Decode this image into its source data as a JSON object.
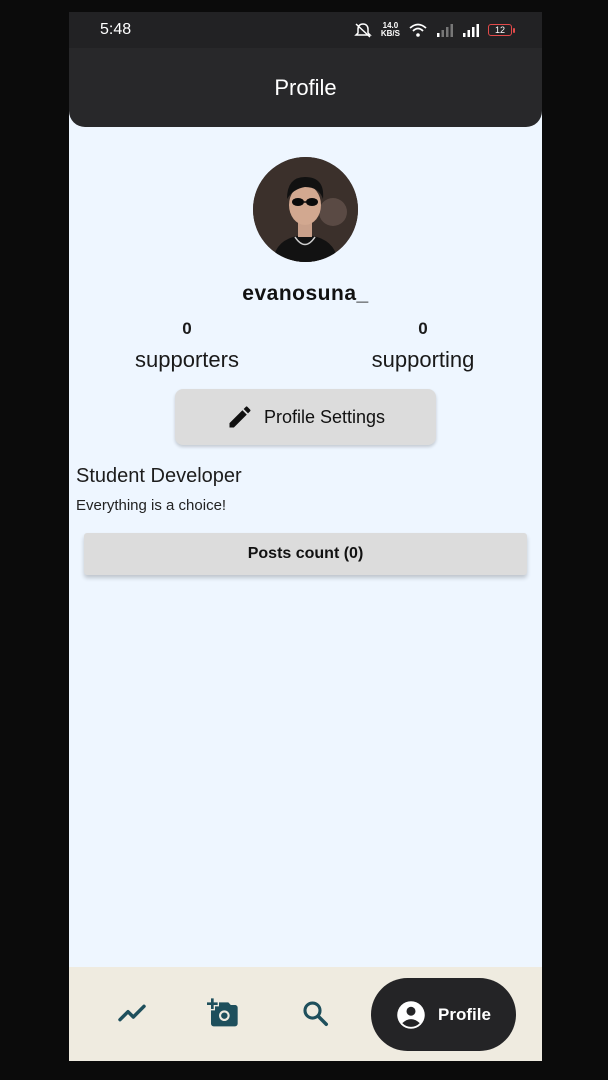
{
  "status_bar": {
    "time": "5:48",
    "net_speed_value": "14.0",
    "net_speed_unit": "KB/S",
    "battery": "12",
    "icons": [
      "mute-icon",
      "wifi-icon",
      "signal-icon",
      "signal-icon",
      "battery-icon"
    ]
  },
  "app_bar": {
    "title": "Profile"
  },
  "profile": {
    "username": "evanosuna_",
    "supporters_count": "0",
    "supporters_label": "supporters",
    "supporting_count": "0",
    "supporting_label": "supporting",
    "settings_button_label": "Profile Settings",
    "settings_icon": "pencil-icon",
    "bio_title": "Student Developer",
    "bio_text": "Everything is a choice!",
    "posts_button_label": "Posts count (0)"
  },
  "bottom_nav": {
    "items": [
      {
        "icon": "trending-icon"
      },
      {
        "icon": "add-photo-icon"
      },
      {
        "icon": "search-icon"
      }
    ],
    "active": {
      "icon": "account-circle-icon",
      "label": "Profile"
    }
  },
  "colors": {
    "background": "#eef6ff",
    "app_bar": "#28282a",
    "nav_background": "#efebe0",
    "nav_icon": "#1e4f5c",
    "button": "#dcdcdc"
  }
}
